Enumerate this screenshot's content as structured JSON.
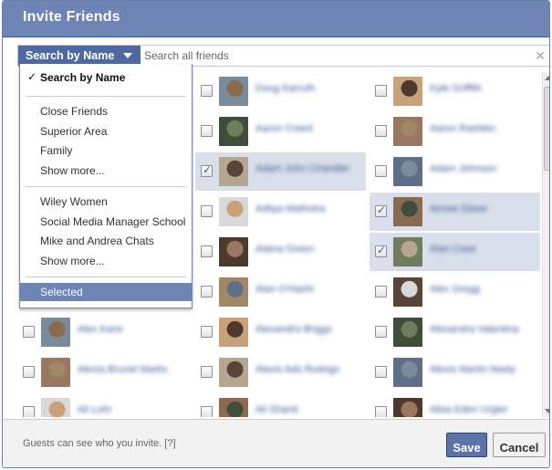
{
  "dialog": {
    "title": "Invite Friends",
    "search_dropdown_label": "Search by Name",
    "search_placeholder": "Search all friends",
    "clear_icon": "close-icon",
    "footer_note": "Guests can see who you invite.  [?]",
    "save_label": "Save",
    "cancel_label": "Cancel"
  },
  "menu": {
    "groups": [
      [
        "Search by Name"
      ],
      [
        "Close Friends",
        "Superior Area",
        "Family",
        "Show more..."
      ],
      [
        "Wiley Women",
        "Social Media Manager School",
        "Mike and Andrea Chats",
        "Show more..."
      ],
      [
        "Selected"
      ]
    ],
    "checked_item": "Search by Name",
    "highlighted_item": "Selected"
  },
  "friends": [
    [
      {
        "name": "Doug Karruth",
        "checked": false
      },
      {
        "name": "Kyle Griffith",
        "checked": false
      }
    ],
    [
      {
        "name": "Aaron Creed",
        "checked": false
      },
      {
        "name": "Aaron Rashkin",
        "checked": false
      }
    ],
    [
      {
        "name": "Adam John Chandler",
        "checked": true
      },
      {
        "name": "Adam Johnson",
        "checked": false
      }
    ],
    [
      {
        "name": "Aditya Malhotra",
        "checked": false
      },
      {
        "name": "Aimee Giese",
        "checked": true
      }
    ],
    [
      {
        "name": "Alaina Green",
        "checked": false
      },
      {
        "name": "Alan Case",
        "checked": true
      }
    ],
    [
      {
        "name": "Alan O'Hashi",
        "checked": false
      },
      {
        "name": "Alec Gregg",
        "checked": false
      }
    ],
    [
      {
        "name": "Alex Karis",
        "checked": false
      },
      {
        "name": "Alexandra Briggs",
        "checked": false
      },
      {
        "name": "Alexandra Valentina",
        "checked": false
      }
    ],
    [
      {
        "name": "Alexia Brunet Marks",
        "checked": false
      },
      {
        "name": "Alexis Ads Rodrigo",
        "checked": false
      },
      {
        "name": "Alexis Martin Neely",
        "checked": false
      }
    ],
    [
      {
        "name": "Ali Lohr",
        "checked": false
      },
      {
        "name": "Ali Shanti",
        "checked": false
      },
      {
        "name": "Alisa Eden Urgler",
        "checked": false
      }
    ]
  ],
  "colors": {
    "titlebar": "#6d84b4",
    "brand": "#3b5998",
    "selected_row": "#d8dfea",
    "avatars": [
      "#8a6b52",
      "#4c3a2c",
      "#6f7d5c",
      "#a08866",
      "#59443a",
      "#7a8c9c",
      "#c9a27a",
      "#3f4e3a",
      "#9b7763",
      "#b6a58f",
      "#5e6f86",
      "#d9d9d9"
    ]
  }
}
